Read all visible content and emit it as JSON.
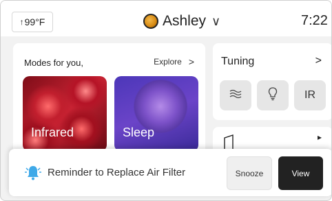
{
  "topbar": {
    "temperature": "99°F",
    "temperature_arrow": "↑",
    "user_name": "Ashley",
    "user_chevron": "∨",
    "time": "7:22"
  },
  "modes": {
    "title": "Modes for you,",
    "explore_label": "Explore",
    "explore_chevron": ">",
    "tiles": [
      {
        "label": "Infrared",
        "image_icon": "red-light-cells-image"
      },
      {
        "label": "Sleep",
        "image_icon": "purple-moon-image"
      }
    ]
  },
  "tuning": {
    "title": "Tuning",
    "chevron": ">",
    "buttons": [
      {
        "icon": "waves-icon",
        "label": "≋"
      },
      {
        "icon": "lightbulb-icon",
        "label": ""
      },
      {
        "icon": "ir-icon",
        "label": "IR"
      }
    ]
  },
  "music": {
    "icon": "music-note-icon",
    "chevron": "▸"
  },
  "notification": {
    "icon": "bell-icon",
    "text": "Reminder to Replace Air Filter",
    "snooze_label": "Snooze",
    "view_label": "View"
  },
  "colors": {
    "accent_bell": "#3fa9e8",
    "view_button": "#222222"
  }
}
